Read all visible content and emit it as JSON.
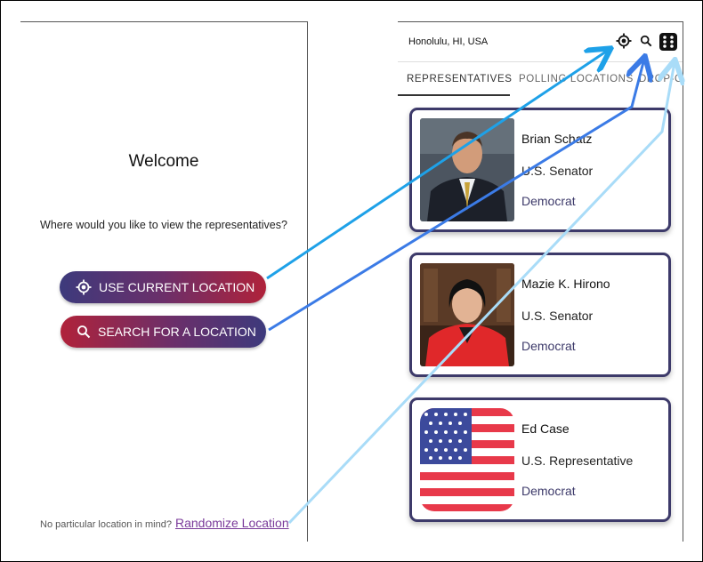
{
  "left": {
    "welcome": "Welcome",
    "prompt": "Where would you like to view the representatives?",
    "use_current_location": "USE CURRENT LOCATION",
    "search_location": "SEARCH FOR A  LOCATION",
    "footer_note": "No particular location in mind?",
    "randomize_link": "Randomize Location"
  },
  "right": {
    "city": "Honolulu, HI, USA",
    "icons": [
      "crosshair-icon",
      "search-icon",
      "dice-icon"
    ],
    "tabs": [
      "REPRESENTATIVES",
      "POLLING LOCATIONS",
      "DROP-OFF"
    ],
    "active_tab": "REPRESENTATIVES",
    "cards": [
      {
        "name": "Brian Schatz",
        "office": "U.S. Senator",
        "party": "Democrat"
      },
      {
        "name": "Mazie K. Hirono",
        "office": "U.S. Senator",
        "party": "Democrat"
      },
      {
        "name": "Ed Case",
        "office": "U.S. Representative",
        "party": "Democrat"
      }
    ]
  },
  "colors": {
    "navy": "#3d3a7c",
    "crimson": "#b0223a",
    "link": "#7a3a9a",
    "arrow_1": "#1ea1e8",
    "arrow_2": "#3b7be6",
    "arrow_3": "#a9dcf8"
  }
}
